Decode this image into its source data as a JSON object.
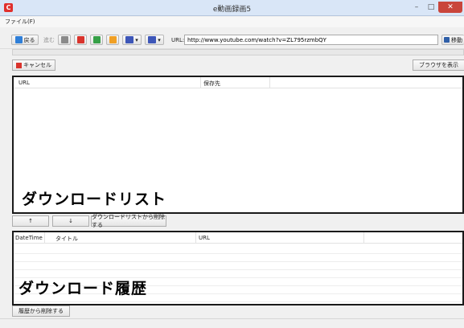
{
  "window": {
    "title": "e動画録画5",
    "app_icon_glyph": "C",
    "minimize_glyph": "–",
    "maximize_glyph": "□",
    "close_glyph": "✕"
  },
  "menu": {
    "file": "ファイル(F)"
  },
  "toolbar": {
    "back_label": "戻る",
    "forward_label": "進む",
    "url_label": "URL:",
    "url_value": "http://www.youtube.com/watch?v=ZL795rzmbQY",
    "go_label": "移動",
    "colors": {
      "back": "#2f7fd8",
      "stop": "#8a8a8a",
      "close": "#d9332c",
      "refresh": "#36a047",
      "home": "#f0a025",
      "capture": "#3d56b8",
      "menu": "#3d56b8",
      "go": "#2f5fa8"
    }
  },
  "actions": {
    "cancel_label": "キャンセル",
    "show_browser_label": "ブラウザを表示"
  },
  "download_list": {
    "columns": [
      "URL",
      "保存先"
    ],
    "overlay_label": "ダウンロードリスト"
  },
  "list_controls": {
    "up_label": "↑",
    "down_label": "↓",
    "remove_label": "ダウンロードリストから削除する"
  },
  "history": {
    "columns": [
      "DateTime",
      "タイトル",
      "URL"
    ],
    "overlay_label": "ダウンロード履歴",
    "remove_label": "履歴から削除する"
  }
}
